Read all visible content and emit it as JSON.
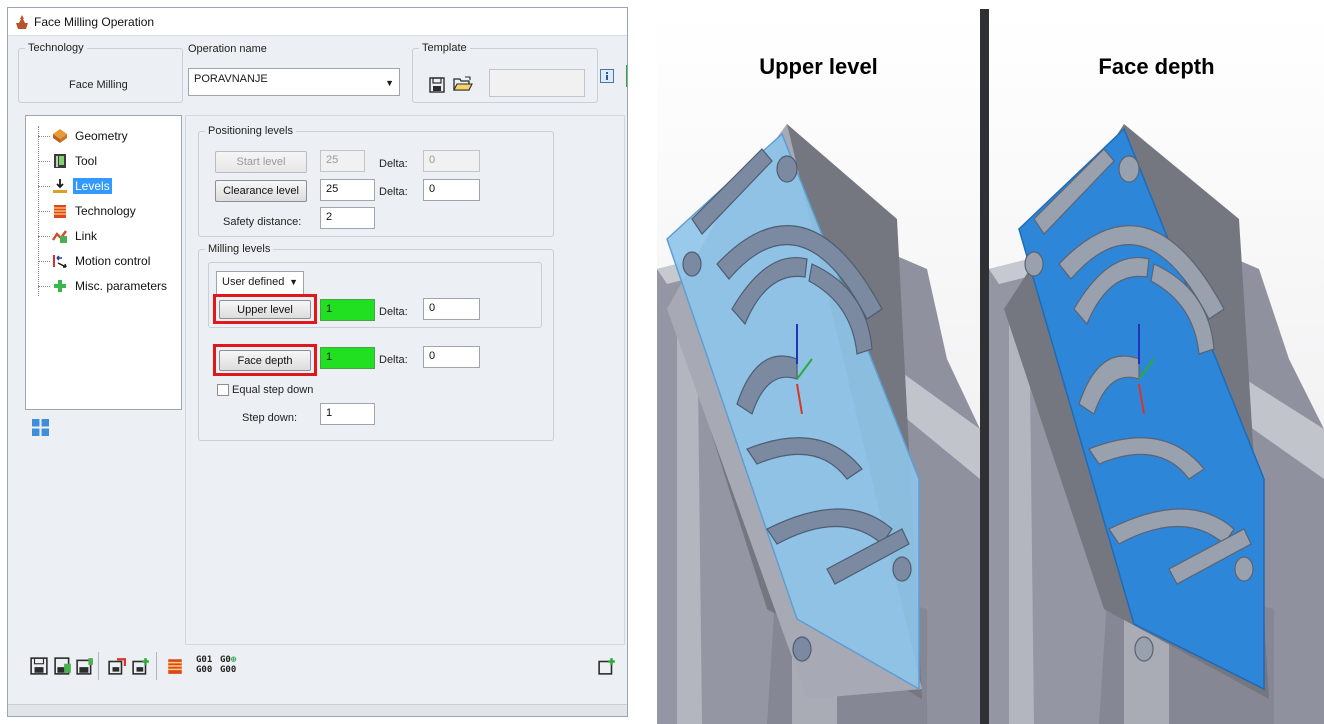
{
  "window": {
    "title": "Face Milling Operation"
  },
  "technology": {
    "legend": "Technology",
    "value": "Face Milling"
  },
  "operation": {
    "legend": "Operation name",
    "value": "PORAVNANJE"
  },
  "template": {
    "legend": "Template",
    "value": ""
  },
  "tree": {
    "items": [
      {
        "label": "Geometry",
        "icon": "geometry-icon"
      },
      {
        "label": "Tool",
        "icon": "tool-icon"
      },
      {
        "label": "Levels",
        "icon": "levels-icon",
        "selected": true
      },
      {
        "label": "Technology",
        "icon": "technology-icon"
      },
      {
        "label": "Link",
        "icon": "link-icon"
      },
      {
        "label": "Motion control",
        "icon": "motion-control-icon"
      },
      {
        "label": "Misc. parameters",
        "icon": "misc-parameters-icon"
      }
    ]
  },
  "positioning": {
    "legend": "Positioning levels",
    "start_level": {
      "label": "Start level",
      "value": "25",
      "delta_label": "Delta:",
      "delta": "0"
    },
    "clearance_level": {
      "label": "Clearance level",
      "value": "25",
      "delta_label": "Delta:",
      "delta": "0"
    },
    "safety_distance": {
      "label": "Safety distance:",
      "value": "2"
    }
  },
  "milling": {
    "legend": "Milling levels",
    "mode": "User defined",
    "upper_level": {
      "label": "Upper level",
      "value": "1",
      "delta_label": "Delta:",
      "delta": "0"
    },
    "face_depth": {
      "label": "Face depth",
      "value": "1",
      "delta_label": "Delta:",
      "delta": "0"
    },
    "equal_step_down": {
      "label": "Equal step down",
      "checked": false
    },
    "step_down": {
      "label": "Step down:",
      "value": "1"
    }
  },
  "toolbar": {
    "gcode_a": [
      "G01",
      "G00"
    ],
    "gcode_b": [
      "G0",
      "G00"
    ]
  },
  "panels": {
    "left_title": "Upper level",
    "right_title": "Face depth"
  },
  "colors": {
    "highlight": "#e0171b",
    "green_field": "#21e021",
    "selection": "#3399ff",
    "upper_face": "#8ec4ea",
    "face_depth": "#2e86d8"
  }
}
